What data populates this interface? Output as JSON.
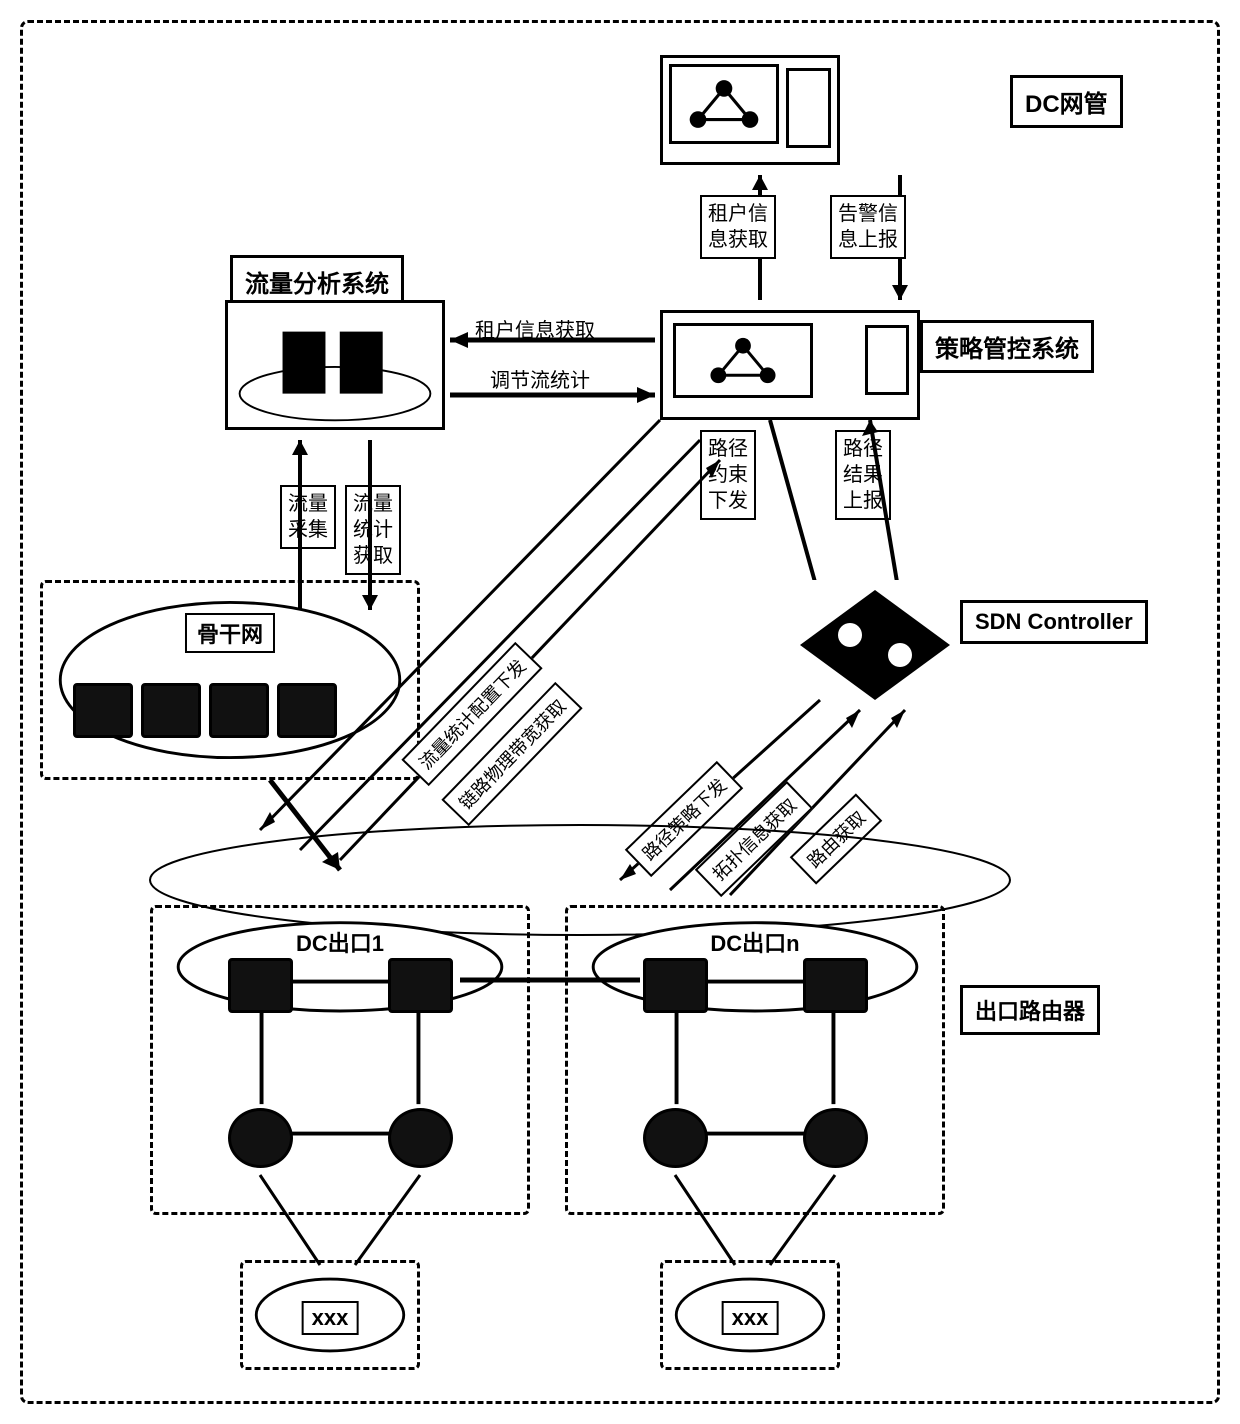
{
  "top": {
    "dc_mgr_label": "DC网管",
    "tenant_info": "租户信\n息获取",
    "alarm_report": "告警信\n息上报"
  },
  "traffic_system": {
    "title": "流量分析系统",
    "tenant_info": "租户信息获取",
    "flow_stat": "调节流统计"
  },
  "policy_system": {
    "title": "策略管控系统",
    "path_constraint": "路径\n约束\n下发",
    "path_result": "路径\n结果\n上报"
  },
  "left_labels": {
    "collect": "流量\n采集",
    "stat": "流量\n统计\n获取"
  },
  "diag_labels": {
    "stat_config": "流量统计配置下发",
    "link_bw": "链路物理带宽获取",
    "route_policy": "路径策略下发",
    "topo_info": "拓扑信息获取",
    "route_get": "路由获取"
  },
  "sdn": {
    "label": "SDN Controller"
  },
  "backbone": {
    "label": "骨干网"
  },
  "dc_exits": {
    "exit1": "DC出口1",
    "exitn": "DC出口n",
    "egress_router": "出口路由器"
  },
  "bottom": {
    "xxx": "xxx"
  }
}
